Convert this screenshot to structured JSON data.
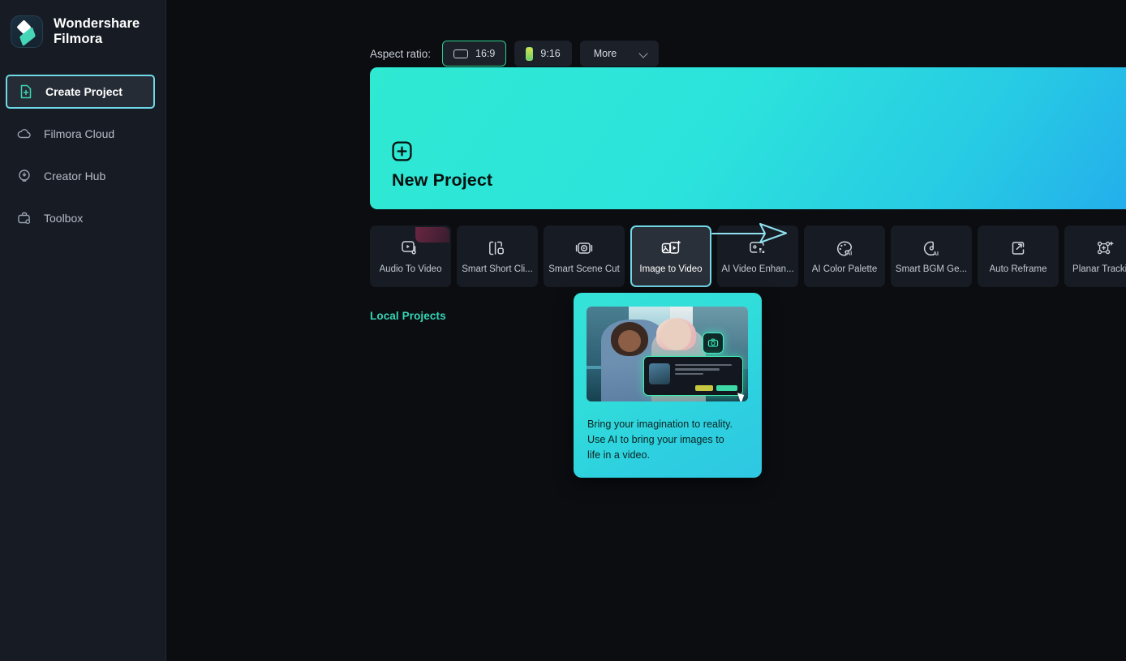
{
  "app": {
    "brand_line1": "Wondershare",
    "brand_line2": "Filmora",
    "brand_name": "Wondershare\nFilmora",
    "logo_icon": "filmora-logo-icon",
    "bg_color": "#0b0d11",
    "sidebar_color": "#161b24",
    "accent_color": "#35d6b7",
    "highlight_color": "#6fd9e8"
  },
  "sidebar": {
    "items": [
      {
        "label": "Create Project",
        "icon": "file-plus-icon",
        "active": true
      },
      {
        "label": "Filmora Cloud",
        "icon": "cloud-icon",
        "active": false
      },
      {
        "label": "Creator Hub",
        "icon": "lightbulb-icon",
        "active": false
      },
      {
        "label": "Toolbox",
        "icon": "toolbox-icon",
        "active": false
      }
    ]
  },
  "aspect_ratio": {
    "label": "Aspect ratio:",
    "options": [
      {
        "label": "16:9",
        "icon": "landscape-frame-icon",
        "selected": true
      },
      {
        "label": "9:16",
        "icon": "portrait-frame-icon",
        "selected": false
      }
    ],
    "more_label": "More",
    "more_icon": "chevron-down-icon"
  },
  "banner": {
    "title": "New Project",
    "icon": "plus-square-icon",
    "gradient_from": "#2fe9d2",
    "gradient_to": "#2196f3"
  },
  "tools": [
    {
      "label": "Audio To Video",
      "icon": "audio-to-video-icon",
      "highlighted": false,
      "badge": true
    },
    {
      "label": "Smart Short Cli...",
      "icon": "smart-short-clips-icon",
      "highlighted": false,
      "badge": false
    },
    {
      "label": "Smart Scene Cut",
      "icon": "smart-scene-cut-icon",
      "highlighted": false,
      "badge": false
    },
    {
      "label": "Image to Video",
      "icon": "image-to-video-icon",
      "highlighted": true,
      "badge": false
    },
    {
      "label": "AI Video Enhan...",
      "icon": "ai-video-enhancer-icon",
      "highlighted": false,
      "badge": false
    },
    {
      "label": "AI Color Palette",
      "icon": "ai-color-palette-icon",
      "highlighted": false,
      "badge": false
    },
    {
      "label": "Smart BGM Ge...",
      "icon": "smart-bgm-generate-icon",
      "highlighted": false,
      "badge": false
    },
    {
      "label": "Auto Reframe",
      "icon": "auto-reframe-icon",
      "highlighted": false,
      "badge": false
    },
    {
      "label": "Planar Tracking",
      "icon": "planar-tracking-icon",
      "highlighted": false,
      "badge": false
    }
  ],
  "sections": {
    "local_projects": "Local Projects"
  },
  "tooltip": {
    "description": "Bring your imagination to reality. Use AI to bring your images to life in a video.",
    "preview_alt": "two-women-smiling-city-photo",
    "bg_from": "#34e3d8",
    "bg_to": "#2fc7e2"
  },
  "annotation": {
    "arrow": "right-arrow-annotation",
    "arrow_color": "#8fe2f0"
  }
}
